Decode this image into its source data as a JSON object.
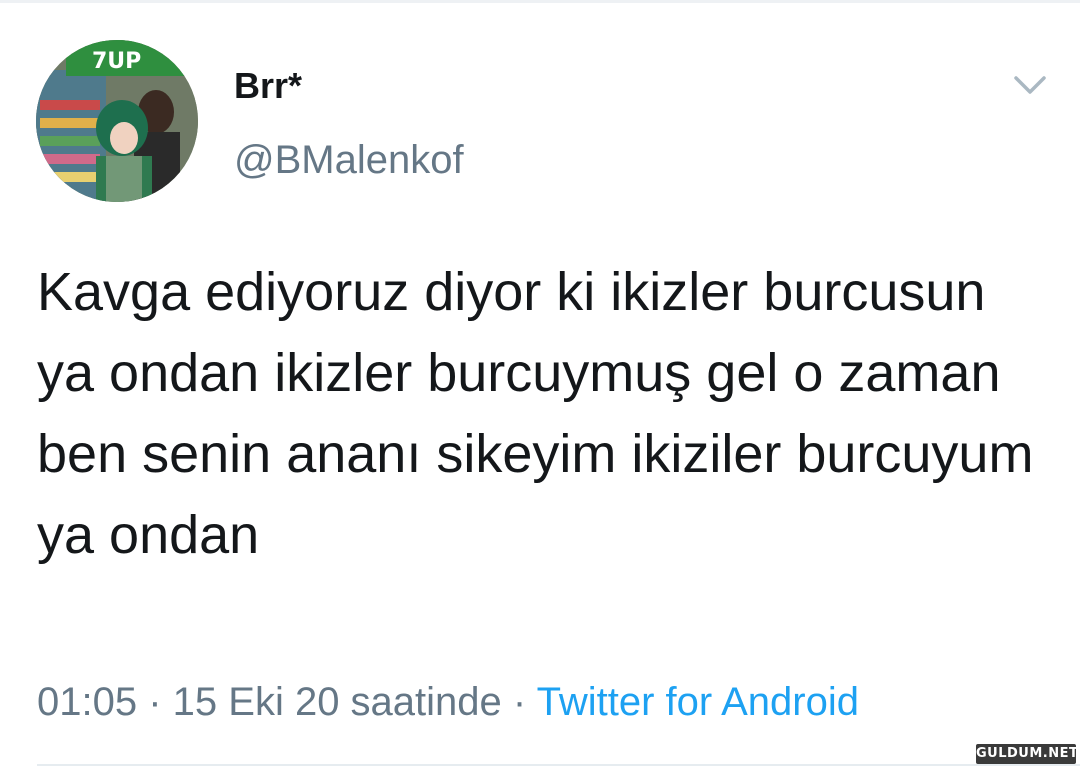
{
  "tweet": {
    "display_name": "Brr*",
    "handle": "@BMalenkof",
    "text": "Kavga ediyoruz diyor ki ikizler burcusun ya ondan ikizler burcuymuş gel o zaman ben senin ananı sikeyim ikiziler burcuyum ya ondan",
    "time": "01:05",
    "separator": " · ",
    "date": "15 Eki 20 saatinde",
    "source": "Twitter for Android"
  },
  "icons": {
    "menu": "chevron-down-icon",
    "avatar": "profile-photo"
  },
  "avatar_logo_text": "7UP",
  "watermark": "GULDUM.NET",
  "colors": {
    "text": "#14171a",
    "secondary": "#657786",
    "link": "#1da1f2",
    "divider": "#e6ecf0"
  }
}
